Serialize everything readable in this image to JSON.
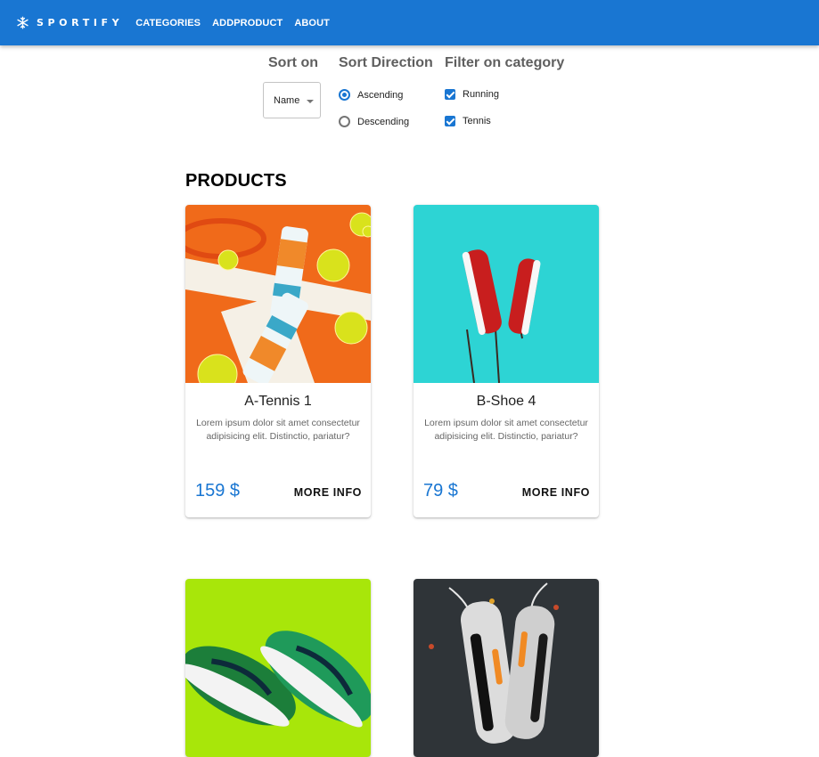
{
  "header": {
    "brand": "SPORTIFY",
    "brand_icon": "snowflake-icon",
    "nav": [
      "CATEGORIES",
      "ADDPRODUCT",
      "ABOUT"
    ],
    "bar_color": "#1976d2"
  },
  "filters": {
    "sort_on": {
      "title": "Sort on",
      "selected": "Name"
    },
    "sort_direction": {
      "title": "Sort Direction",
      "options": [
        "Ascending",
        "Descending"
      ],
      "selected": "Ascending"
    },
    "category": {
      "title": "Filter on category",
      "options": [
        "Running",
        "Tennis"
      ],
      "checked": [
        "Running",
        "Tennis"
      ]
    }
  },
  "products_title": "PRODUCTS",
  "products": [
    {
      "name": "A-Tennis 1",
      "description": "Lorem ipsum dolor sit amet consectetur adipisicing elit. Distinctio, pariatur?",
      "price": "159 $",
      "action": "MORE INFO",
      "image": "tennis-balls-and-cans-photo"
    },
    {
      "name": "B-Shoe 4",
      "description": "Lorem ipsum dolor sit amet consectetur adipisicing elit. Distinctio, pariatur?",
      "price": "79 $",
      "action": "MORE INFO",
      "image": "red-sneakers-photo"
    },
    {
      "image": "green-running-shoes-photo"
    },
    {
      "image": "grey-sneakers-photo"
    }
  ]
}
